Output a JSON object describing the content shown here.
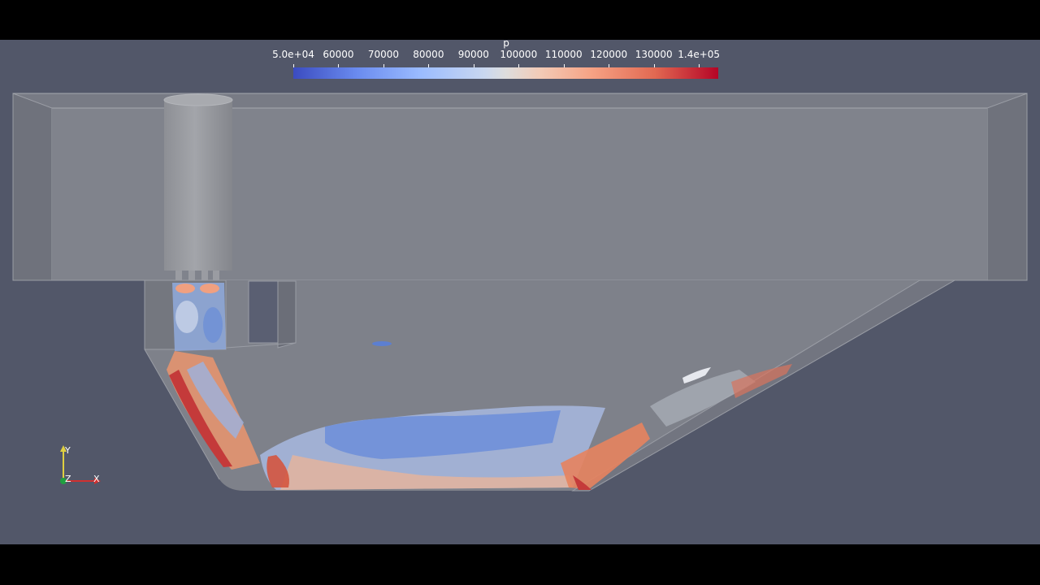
{
  "colorbar": {
    "title": "p",
    "labels": [
      "5.0e+04",
      "60000",
      "70000",
      "80000",
      "90000",
      "100000",
      "110000",
      "120000",
      "130000",
      "1.4e+05"
    ],
    "colors": [
      "#3b4cc0",
      "#dddddd",
      "#b40426"
    ]
  },
  "axes": {
    "y": "Y",
    "z": "Z",
    "x": "X",
    "colors": {
      "x": "#d03030",
      "y": "#e0d040",
      "z": "#20a040"
    }
  },
  "scene": {
    "background": "#525769",
    "wall_color": "#8a8d96"
  }
}
